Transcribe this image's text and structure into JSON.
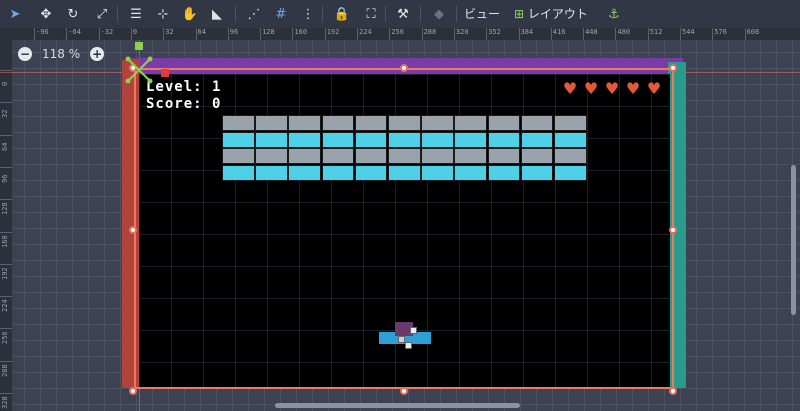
{
  "toolbar": {
    "view_label": "ビュー",
    "layout_label": "レイアウト"
  },
  "rulers": {
    "top": [
      "-96",
      "-64",
      "-32",
      "0",
      "32",
      "64",
      "96",
      "128",
      "160",
      "192",
      "224",
      "256",
      "288",
      "320",
      "352",
      "384",
      "416",
      "448",
      "480",
      "512",
      "544",
      "576",
      "608"
    ],
    "left": [
      "0",
      "32",
      "64",
      "96",
      "128",
      "160",
      "192",
      "224",
      "256",
      "288",
      "320"
    ]
  },
  "zoom": {
    "minus": "−",
    "level": "118 %",
    "plus": "+"
  },
  "hud": {
    "level_text": "Level: 1",
    "score_text": "Score: 0",
    "lives": 5
  },
  "bricks": {
    "columns": 11,
    "rows": [
      "gray",
      "cyan",
      "gray",
      "cyan"
    ]
  },
  "colors": {
    "wall_left": "#b0433c",
    "wall_top": "#7a3aa8",
    "wall_right": "#2a9a8a",
    "paddle": "#2ea0d8",
    "heart": "#e55a34",
    "selection": "#f07a60"
  }
}
